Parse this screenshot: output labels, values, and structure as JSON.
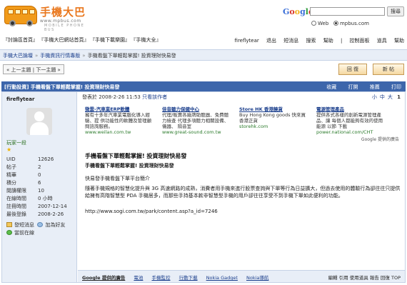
{
  "header": {
    "logo_title": "手機大巴",
    "logo_url": "www.mpbus.com",
    "logo_sub": "MOBILE PHONE BUS",
    "google_letters": [
      "G",
      "o",
      "o",
      "g",
      "l",
      "e"
    ],
    "search_button": "搜尋",
    "radio_web": "Web",
    "radio_site": "mpbus.com"
  },
  "quick_links": [
    "『討論區首頁』",
    "『手機大巴網站首頁』",
    "『手機下載樂園』",
    "『手機大全』"
  ],
  "user_links": [
    "fireflytear",
    "退出",
    "短消息",
    "搜索",
    "幫助",
    "|",
    "控制面板",
    "道具",
    "幫助"
  ],
  "breadcrumb": {
    "items": [
      "手機大巴論壇",
      "手機資訊行情專版",
      "手機看盤下單輕鬆掌握! 投資理財快易發"
    ],
    "sep": "»"
  },
  "prevnext": "« 上一主題 | 下一主題 »",
  "buttons": {
    "reply": "回 復",
    "new": "新 帖"
  },
  "titlebar": {
    "title": "[行動投資] 手機看盤下單輕鬆掌握! 投資理財快易發",
    "actions": [
      "收藏",
      "打開",
      "推薦",
      "打印"
    ]
  },
  "author": {
    "name": "fireflytear",
    "rank": "玩家一段",
    "stars": "★",
    "stats": [
      {
        "label": "UID",
        "value": "12626"
      },
      {
        "label": "帖子",
        "value": "2"
      },
      {
        "label": "精華",
        "value": "0"
      },
      {
        "label": "積分",
        "value": "6"
      },
      {
        "label": "閱讀權限",
        "value": "10"
      },
      {
        "label": "在線時間",
        "value": "0 小時"
      },
      {
        "label": "註冊時間",
        "value": "2007-12-14"
      },
      {
        "label": "最後登錄",
        "value": "2008-2-26"
      }
    ],
    "send_msg": "發短消息",
    "add_friend": "加為好友",
    "online": "當前在線"
  },
  "post": {
    "meta_posted": "發表於 2008-2-26 11:53",
    "meta_only": "只看該作者",
    "font_small": "小",
    "font_mid": "中",
    "font_big": "大",
    "floor": "1",
    "title": "手機看盤下單輕鬆掌握! 投資理財快易發",
    "body_line1": "手機看盤下單輕鬆掌握! 投資理財快易發",
    "body_line2": "快易發手機看盤下單平台簡介",
    "body_para": "隨著手機規格的智慧化提升與 3G 高速網路的成熟，消費者用手機來進行股票查詢與下單等行為日益擴大，但過去使用的體驗行為卻往往只提供給擁有高階智慧型 PDA 手機居多，而那些手持基本款非智慧型手機的用戶卻往往享受不到手機下單如此便利的功能。",
    "link": "http://www.sogi.com.tw/park/content.asp?a_id=7246"
  },
  "ads": [
    {
      "title": "微雲-汽車業ERP軟體",
      "desc": "擁有十多年汽車業電腦化導入經驗、提 供功能性的軟體及管理顧問諮詢服務。",
      "url": "www.weilan.com.tw"
    },
    {
      "title": "佳音聽力保健中心",
      "desc": "代理/販賣各廠牌助聽器、免費聽力檢查 代理多項聽力相關設備、儀器、 隔音室",
      "url": "www.great-sound.com.tw"
    },
    {
      "title": "Store HK 香港饒貨",
      "desc": "Buy Hong Kong goods 快來買香港正貨",
      "url": "storehk.com"
    },
    {
      "title": "電源管理產品",
      "desc": "提供各式各樣的創新電源管理產品、讓 每個人都能夠有效的使用能源 以節 下載",
      "url": "power.national.com/CHT"
    }
  ],
  "ads_by": "Google 提供的廣告",
  "footer": {
    "google_ads": "Google 提供的廣告",
    "links": [
      "電池",
      "手機監控",
      "行動下載",
      "Nokia Gadget",
      "Nokia導航"
    ],
    "actions": "編輯 引用 使用道具 報告 回復 TOP"
  }
}
